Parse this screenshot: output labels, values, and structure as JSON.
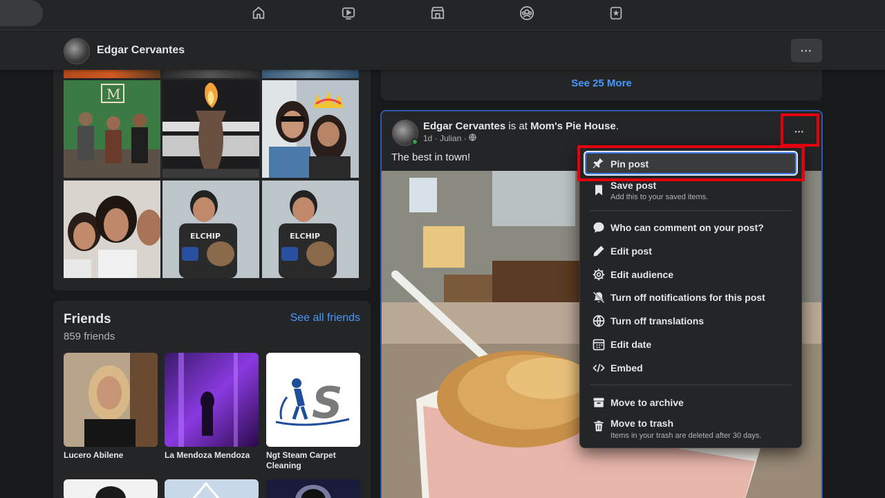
{
  "nav": {
    "icons": [
      "home-icon",
      "watch-icon",
      "marketplace-icon",
      "groups-icon",
      "gaming-icon"
    ]
  },
  "profile_bar": {
    "name": "Edgar Cervantes",
    "more_label": "···"
  },
  "photos": {
    "see_more_label": "See 25 More"
  },
  "friends": {
    "title": "Friends",
    "count": "859 friends",
    "see_all": "See all friends",
    "items": [
      {
        "name": "Lucero Abilene"
      },
      {
        "name": "La Mendoza Mendoza"
      },
      {
        "name": "Ngt Steam Carpet Cleaning"
      }
    ]
  },
  "post": {
    "author": "Edgar Cervantes",
    "is_at": " is at ",
    "place": "Mom's Pie House",
    "place_suffix": ".",
    "meta": "1d · Julian ·",
    "text": "The best in town!",
    "more_label": "···"
  },
  "menu": {
    "items": [
      {
        "label": "Pin post",
        "icon": "pin-icon"
      },
      {
        "label": "Save post",
        "sub": "Add this to your saved items.",
        "icon": "bookmark-icon"
      },
      {
        "label": "Who can comment on your post?",
        "icon": "comment-icon"
      },
      {
        "label": "Edit post",
        "icon": "pencil-icon"
      },
      {
        "label": "Edit audience",
        "icon": "gear-icon"
      },
      {
        "label": "Turn off notifications for this post",
        "icon": "bell-off-icon"
      },
      {
        "label": "Turn off translations",
        "icon": "globe-icon"
      },
      {
        "label": "Edit date",
        "icon": "calendar-icon"
      },
      {
        "label": "Embed",
        "icon": "code-icon"
      },
      {
        "label": "Move to archive",
        "icon": "archive-icon"
      },
      {
        "label": "Move to trash",
        "sub": "Items in your trash are deleted after 30 days.",
        "icon": "trash-icon"
      }
    ]
  },
  "colors": {
    "background": "#18191a",
    "surface": "#242526",
    "link": "#4599ff",
    "highlight": "#e4000f"
  }
}
